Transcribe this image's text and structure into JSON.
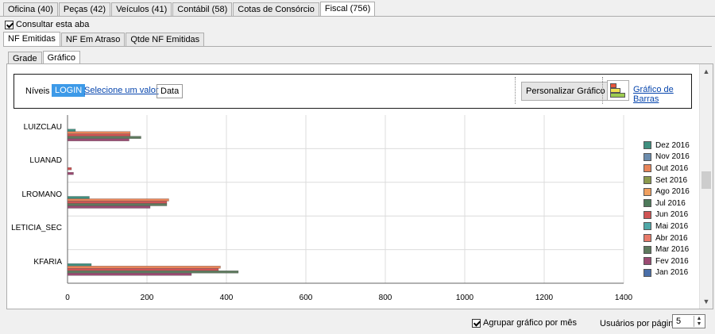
{
  "top_tabs": [
    {
      "label": "Oficina (40)",
      "active": false
    },
    {
      "label": "Peças (42)",
      "active": false
    },
    {
      "label": "Veículos (41)",
      "active": false
    },
    {
      "label": "Contábil (58)",
      "active": false
    },
    {
      "label": "Cotas de Consórcio",
      "active": false
    },
    {
      "label": "Fiscal (756)",
      "active": true
    }
  ],
  "consult_label": "Consultar esta aba",
  "sub_tabs": [
    {
      "label": "NF Emitidas",
      "active": true
    },
    {
      "label": "NF Em Atraso",
      "active": false
    },
    {
      "label": "Qtde NF Emitidas",
      "active": false
    }
  ],
  "view_tabs": [
    {
      "label": "Grade",
      "active": false
    },
    {
      "label": "Gráfico",
      "active": true
    }
  ],
  "levels": {
    "label": "Níveis",
    "login": "LOGIN",
    "select": "Selecione um valor",
    "data": "Data"
  },
  "customize_button": "Personalizar Gráfico",
  "chart_type_link": "Gráfico de Barras",
  "group_by_month_label": "Agrupar gráfico por mês",
  "users_per_page_label": "Usuários por página",
  "users_per_page_value": "5",
  "chart_data": {
    "type": "bar",
    "orientation": "horizontal",
    "categories": [
      "LUIZCLAU",
      "LUANAD",
      "LROMANO",
      "LETICIA_SEC",
      "KFARIA"
    ],
    "xlim": [
      0,
      1400
    ],
    "xticks": [
      0,
      200,
      400,
      600,
      800,
      1000,
      1200,
      1400
    ],
    "grid": true,
    "legend_position": "right",
    "series": [
      {
        "name": "Dez 2016",
        "color": "#3f8f7f",
        "values": [
          20,
          0,
          55,
          0,
          60
        ]
      },
      {
        "name": "Nov 2016",
        "color": "#6b8cad",
        "values": [
          0,
          0,
          0,
          0,
          0
        ]
      },
      {
        "name": "Out 2016",
        "color": "#e8855a",
        "values": [
          158,
          0,
          255,
          0,
          385
        ]
      },
      {
        "name": "Set 2016",
        "color": "#8c9a4d",
        "values": [
          0,
          0,
          0,
          0,
          0
        ]
      },
      {
        "name": "Ago 2016",
        "color": "#f0a060",
        "values": [
          0,
          0,
          0,
          0,
          0
        ]
      },
      {
        "name": "Jul 2016",
        "color": "#4d7a5a",
        "values": [
          0,
          0,
          0,
          0,
          0
        ]
      },
      {
        "name": "Jun 2016",
        "color": "#cf5454",
        "values": [
          158,
          10,
          250,
          0,
          380
        ]
      },
      {
        "name": "Mai 2016",
        "color": "#4fa8a8",
        "values": [
          0,
          0,
          0,
          0,
          0
        ]
      },
      {
        "name": "Abr 2016",
        "color": "#e87a6a",
        "values": [
          0,
          0,
          0,
          0,
          0
        ]
      },
      {
        "name": "Mar 2016",
        "color": "#5e7a5e",
        "values": [
          185,
          0,
          250,
          0,
          430
        ]
      },
      {
        "name": "Fev 2016",
        "color": "#9b4a72",
        "values": [
          155,
          15,
          208,
          0,
          312
        ]
      },
      {
        "name": "Jan 2016",
        "color": "#4a6fa8",
        "values": [
          0,
          0,
          0,
          0,
          0
        ]
      }
    ]
  }
}
